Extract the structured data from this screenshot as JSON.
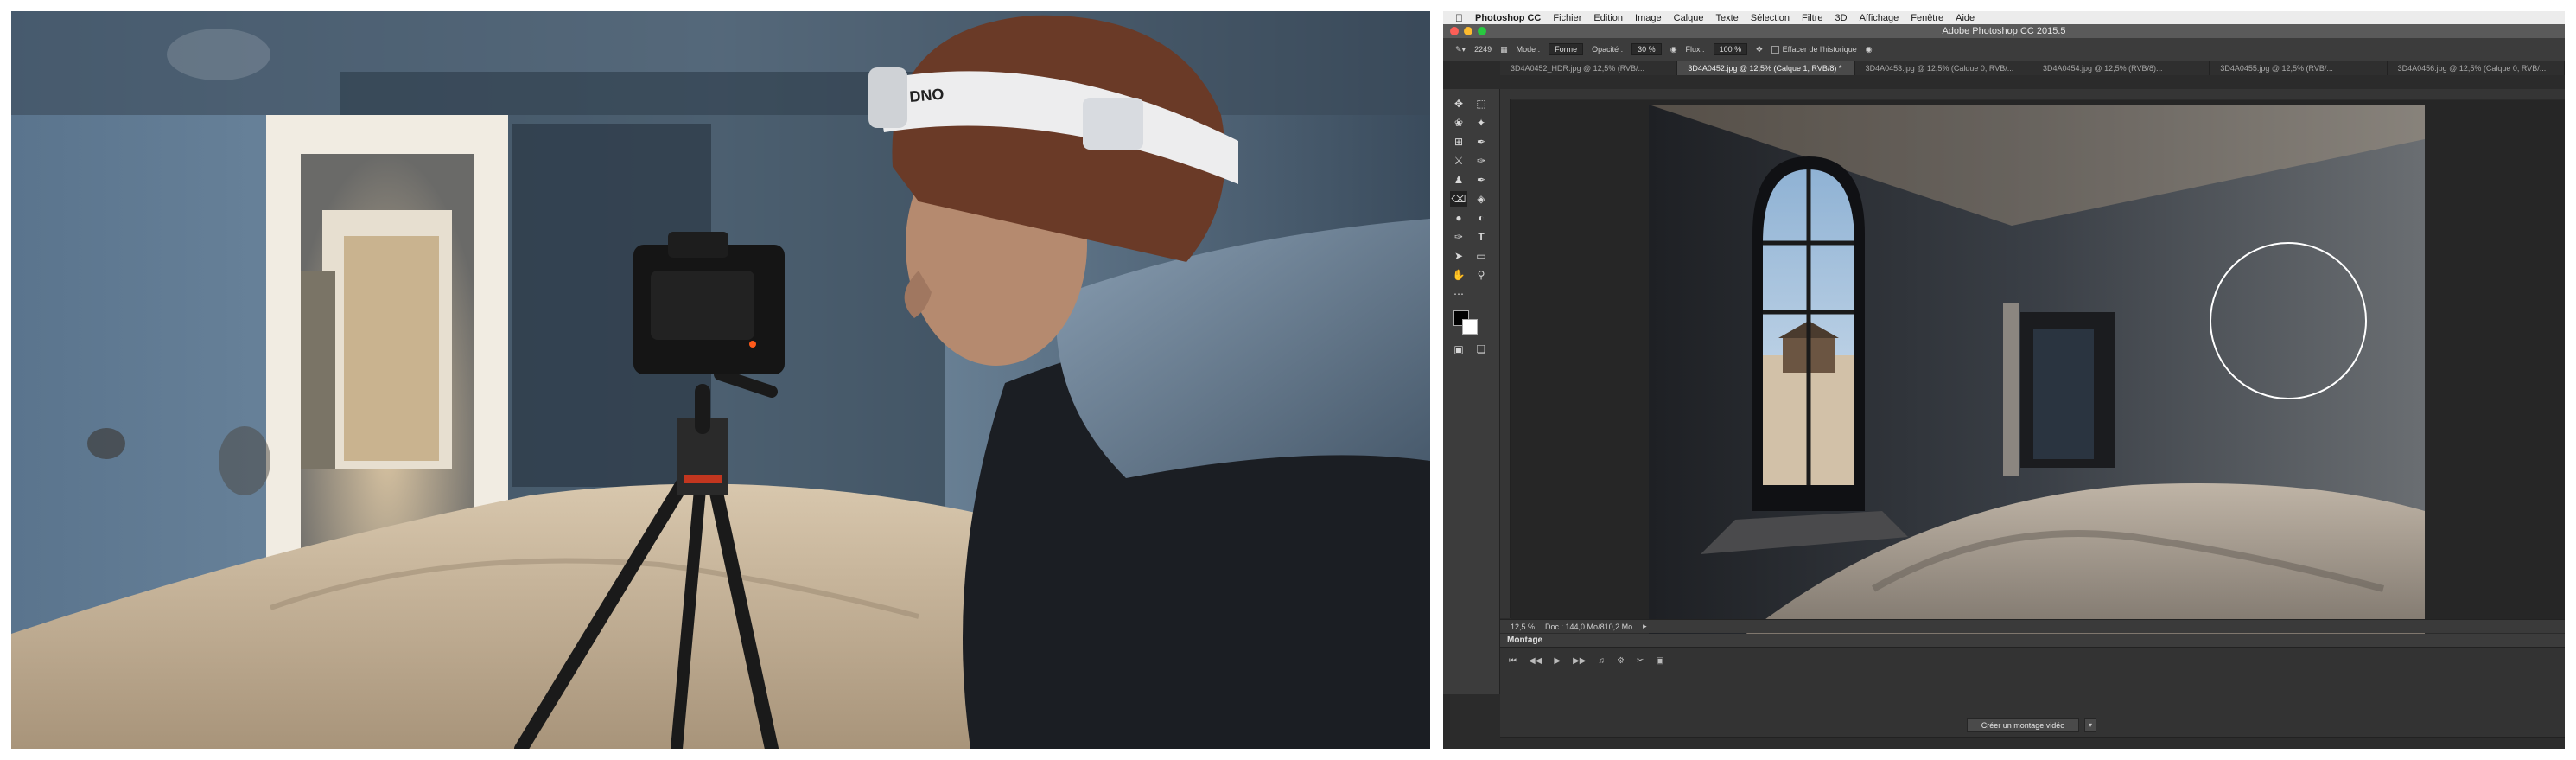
{
  "menubar": {
    "app_name": "Photoshop CC",
    "items": [
      "Fichier",
      "Edition",
      "Image",
      "Calque",
      "Texte",
      "Sélection",
      "Filtre",
      "3D",
      "Affichage",
      "Fenêtre",
      "Aide"
    ]
  },
  "window": {
    "title": "Adobe Photoshop CC 2015.5"
  },
  "options": {
    "brush_size": "2249",
    "mode_label": "Mode :",
    "mode_value": "Forme",
    "opacity_label": "Opacité :",
    "opacity_value": "30 %",
    "flow_label": "Flux :",
    "flow_value": "100 %",
    "erase_history_label": "Effacer de l'historique"
  },
  "tabs": [
    {
      "label": "3D4A0452_HDR.jpg @ 12,5% (RVB/..."
    },
    {
      "label": "3D4A0452.jpg @ 12,5% (Calque 1, RVB/8) *"
    },
    {
      "label": "3D4A0453.jpg @ 12,5% (Calque 0, RVB/..."
    },
    {
      "label": "3D4A0454.jpg @ 12,5% (RVB/8)..."
    },
    {
      "label": "3D4A0455.jpg @ 12,5% (RVB/..."
    },
    {
      "label": "3D4A0456.jpg @ 12,5% (Calque 0, RVB/..."
    }
  ],
  "status": {
    "zoom": "12,5 %",
    "doc": "Doc : 144,0 Mo/810,2 Mo"
  },
  "timeline": {
    "panel_title": "Montage",
    "create_button": "Créer un montage vidéo"
  },
  "colors": {
    "ui_dark": "#2b2b2b",
    "panel": "#3c3c3c",
    "sand": "#c9b8a0",
    "wall_blue": "#6f8aa3"
  }
}
